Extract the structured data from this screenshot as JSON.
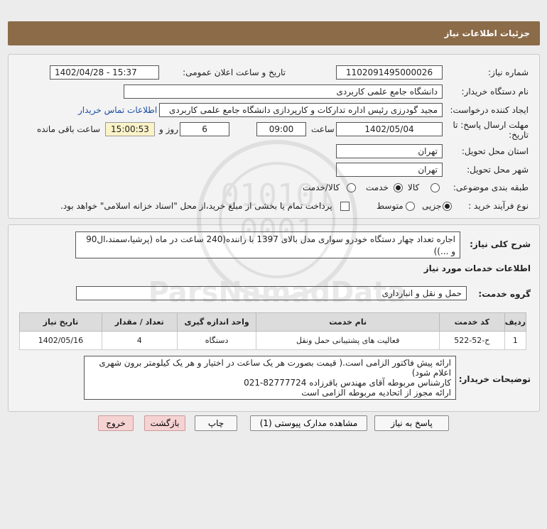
{
  "header": {
    "title": "جزئیات اطلاعات نیاز"
  },
  "fields": {
    "need_number_label": "شماره نیاز:",
    "need_number": "1102091495000026",
    "announce_label": "تاریخ و ساعت اعلان عمومی:",
    "announce_value": "1402/04/28 - 15:37",
    "buyer_label": "نام دستگاه خریدار:",
    "buyer_value": "دانشگاه جامع علمی کاربردی",
    "requester_label": "ایجاد کننده درخواست:",
    "requester_value": "مجید گودرزی رئیس اداره تدارکات و کارپردازی دانشگاه جامع علمی کاربردی",
    "contact_link": "اطلاعات تماس خریدار",
    "deadline_label_1": "مهلت ارسال پاسخ: تا",
    "deadline_label_2": "تاریخ:",
    "deadline_date": "1402/05/04",
    "time_label": "ساعت",
    "deadline_time": "09:00",
    "days_value": "6",
    "days_label": "روز و",
    "remaining_time": "15:00:53",
    "remaining_label": "ساعت باقی مانده",
    "province_label": "استان محل تحویل:",
    "province_value": "تهران",
    "city_label": "شهر محل تحویل:",
    "city_value": "تهران",
    "category_label": "طبقه بندی موضوعی:",
    "category_options": [
      "کالا",
      "خدمت",
      "کالا/خدمت"
    ],
    "process_label": "نوع فرآیند خرید :",
    "process_options": [
      "جزیی",
      "متوسط"
    ],
    "payment_note": "پرداخت تمام یا بخشی از مبلغ خرید،از محل \"اسناد خزانه اسلامی\" خواهد بود."
  },
  "summary": {
    "label": "شرح کلی نیاز:",
    "text": "اجاره تعداد چهار دستگاه خودرو سواری مدل بالای 1397 با راننده(240 ساعت در ماه (پرشیا،سمند،ال90 و ...))"
  },
  "services": {
    "section_title": "اطلاعات خدمات مورد نیاز",
    "group_label": "گروه خدمت:",
    "group_value": "حمل و نقل و انبارداری",
    "table_headers": [
      "ردیف",
      "کد خدمت",
      "نام خدمت",
      "واحد اندازه گیری",
      "تعداد / مقدار",
      "تاریخ نیاز"
    ],
    "rows": [
      {
        "index": "1",
        "code": "ح-52-522",
        "name": "فعالیت های پشتیبانی حمل ونقل",
        "unit": "دستگاه",
        "qty": "4",
        "date": "1402/05/16"
      }
    ]
  },
  "buyer_notes": {
    "label": "توضیحات خریدار:",
    "lines": [
      "ارائه پیش فاکتور الزامی است.( قیمت بصورت هر یک ساعت در اختیار و هر یک کیلومتر برون شهری اعلام شود)",
      "کارشناس مربوطه آقای مهندس باقرزاده 82777724-021",
      "ارائه مجوز از اتحادیه مربوطه الزامی است"
    ]
  },
  "buttons": {
    "reply": "پاسخ به نیاز",
    "attachments": "مشاهده مدارک پیوستی (1)",
    "print": "چاپ",
    "back": "بازگشت",
    "exit": "خروج"
  },
  "watermark": {
    "brand": "ParsNamadData"
  }
}
